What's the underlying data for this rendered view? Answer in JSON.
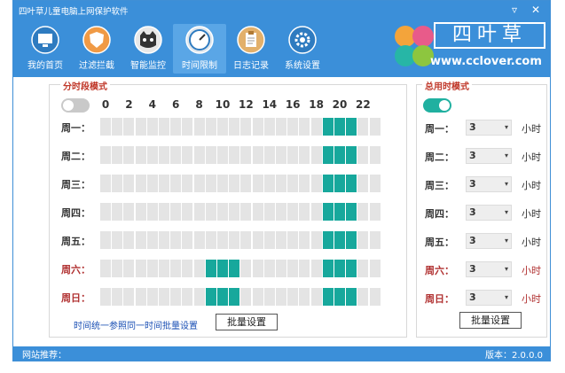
{
  "window": {
    "title": "四叶草儿童电脑上网保护软件",
    "minimize": "▿",
    "close": "✕"
  },
  "nav": [
    {
      "label": "我的首页",
      "icon": "monitor-icon"
    },
    {
      "label": "过滤拦截",
      "icon": "shield-icon"
    },
    {
      "label": "智能监控",
      "icon": "cat-face-icon"
    },
    {
      "label": "时间限制",
      "icon": "clock-icon"
    },
    {
      "label": "日志记录",
      "icon": "clipboard-icon"
    },
    {
      "label": "系统设置",
      "icon": "gear-icon"
    }
  ],
  "active_nav": 3,
  "brand": {
    "logo_text": "四叶草",
    "url": "www.cclover.com",
    "colors": [
      "#f3a43b",
      "#e85b8a",
      "#27b6a6",
      "#8dc63f"
    ]
  },
  "slot_mode": {
    "legend": "分时段模式",
    "enabled": false,
    "hours": [
      "0",
      "2",
      "4",
      "6",
      "8",
      "10",
      "12",
      "14",
      "16",
      "18",
      "20",
      "22"
    ],
    "days": [
      {
        "label": "周一：",
        "weekend": false,
        "on_hours": [
          19,
          20,
          21
        ]
      },
      {
        "label": "周二：",
        "weekend": false,
        "on_hours": [
          19,
          20,
          21
        ]
      },
      {
        "label": "周三：",
        "weekend": false,
        "on_hours": [
          19,
          20,
          21
        ]
      },
      {
        "label": "周四：",
        "weekend": false,
        "on_hours": [
          19,
          20,
          21
        ]
      },
      {
        "label": "周五：",
        "weekend": false,
        "on_hours": [
          19,
          20,
          21
        ]
      },
      {
        "label": "周六：",
        "weekend": true,
        "on_hours": [
          9,
          10,
          11,
          19,
          20,
          21
        ]
      },
      {
        "label": "周日：",
        "weekend": true,
        "on_hours": [
          9,
          10,
          11,
          19,
          20,
          21
        ]
      }
    ],
    "note": "时间统一参照同一时间批量设置",
    "batch_button": "批量设置"
  },
  "total_mode": {
    "legend": "总用时模式",
    "enabled": true,
    "unit": "小时",
    "rows": [
      {
        "label": "周一：",
        "value": "3",
        "weekend": false
      },
      {
        "label": "周二：",
        "value": "3",
        "weekend": false
      },
      {
        "label": "周三：",
        "value": "3",
        "weekend": false
      },
      {
        "label": "周四：",
        "value": "3",
        "weekend": false
      },
      {
        "label": "周五：",
        "value": "3",
        "weekend": false
      },
      {
        "label": "周六：",
        "value": "3",
        "weekend": true
      },
      {
        "label": "周日：",
        "value": "3",
        "weekend": true
      }
    ],
    "batch_button": "批量设置"
  },
  "status": {
    "left": "网站推荐：",
    "right": "版本：2.0.0.0"
  },
  "colors": {
    "accent": "#3b8fd9",
    "slot_on": "#17a89c",
    "slot_off": "#e4e4e4",
    "weekend": "#b03030"
  }
}
